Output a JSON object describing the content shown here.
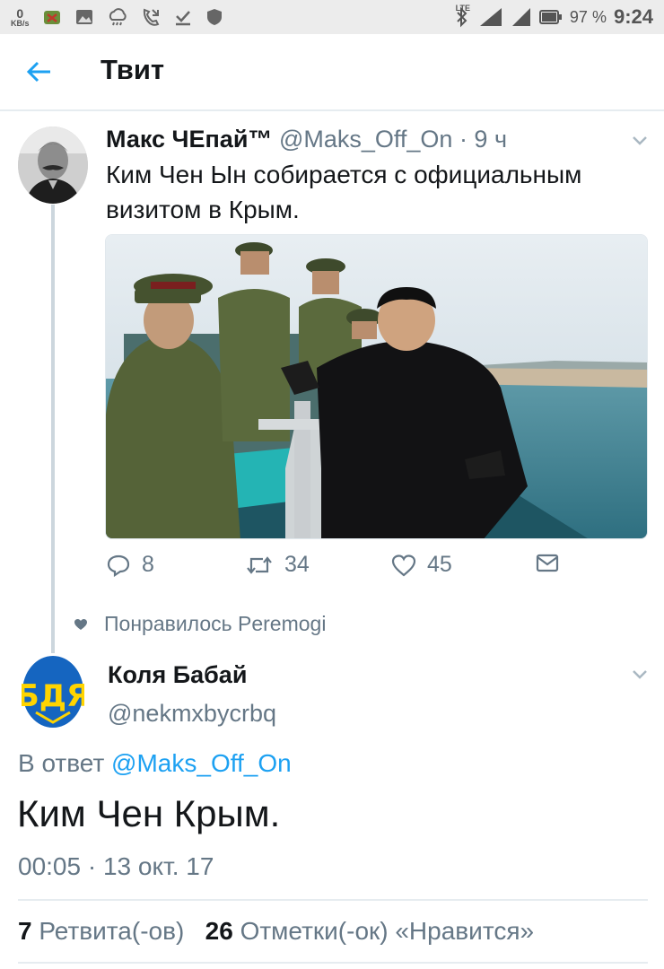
{
  "status_bar": {
    "data_rate_value": "0",
    "data_rate_unit": "KB/s",
    "network_label": "LTE",
    "battery_text": "97 %",
    "time": "9:24"
  },
  "header": {
    "title": "Твит"
  },
  "tweet": {
    "author_name": "Макс ЧЕпай™",
    "author_handle": "@Maks_Off_On",
    "time_ago": "· 9 ч",
    "text": "Ким Чен Ын собирается с официальным визитом в Крым.",
    "actions": {
      "replies": "8",
      "retweets": "34",
      "likes": "45"
    }
  },
  "liked_by": "Понравилось Peremogi",
  "reply_tweet": {
    "author_name": "Коля Бабай",
    "author_handle": "@nekmxbycrbq",
    "reply_prefix": "В ответ",
    "reply_handle": "@Maks_Off_On",
    "text": "Ким Чен Крым.",
    "timestamp": "00:05 · 13 окт. 17",
    "retweets_count": "7",
    "retweets_label": "Ретвита(-ов)",
    "likes_count": "26",
    "likes_label": "Отметки(-ок) «Нравится»"
  },
  "colors": {
    "accent": "#1da1f2",
    "muted": "#657786",
    "text": "#14171a"
  }
}
